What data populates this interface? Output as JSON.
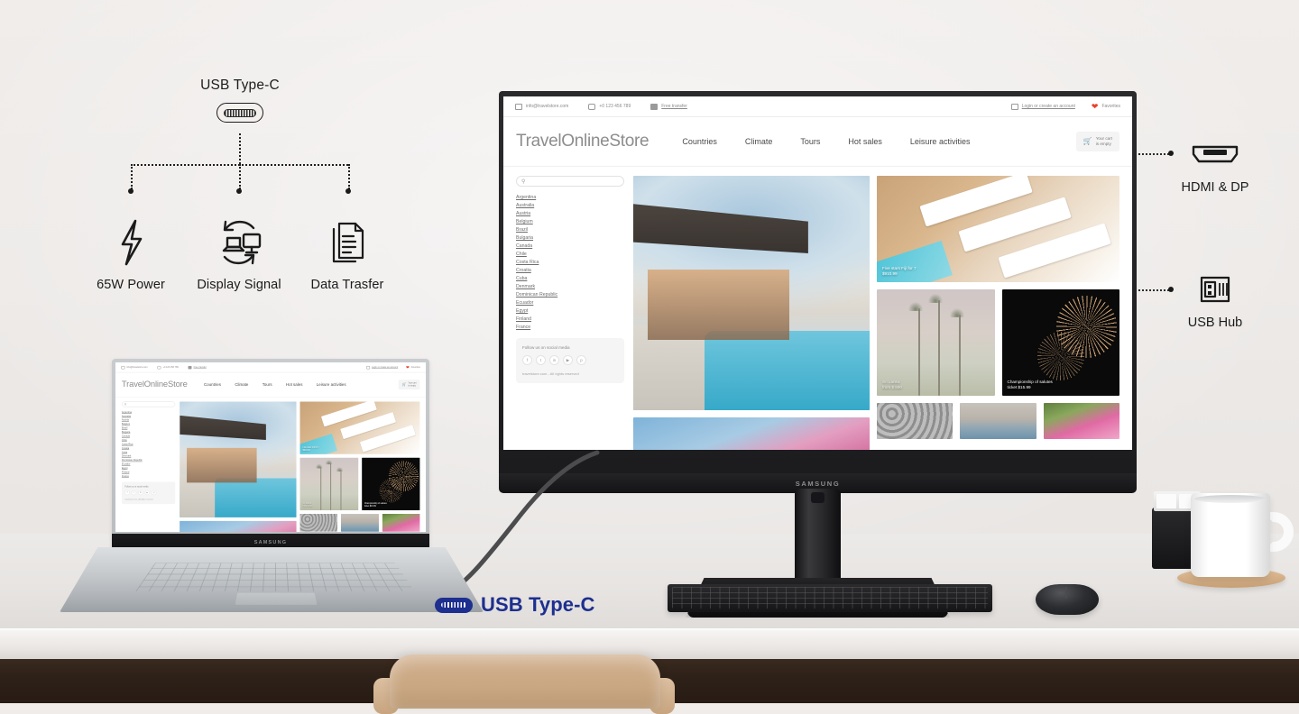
{
  "diagram": {
    "title": "USB Type-C",
    "connector_icon": "usb-c-icon",
    "features": [
      {
        "label": "65W Power",
        "icon": "bolt-icon"
      },
      {
        "label": "Display Signal",
        "icon": "display-sync-icon"
      },
      {
        "label": "Data Trasfer",
        "icon": "documents-icon"
      }
    ]
  },
  "callouts": [
    {
      "label": "HDMI & DP",
      "icon": "hdmi-port-icon"
    },
    {
      "label": "USB Hub",
      "icon": "usb-a-port-icon"
    }
  ],
  "bottom_badge": {
    "label": "USB Type-C",
    "icon": "usb-c-icon",
    "color": "#1d2f8f"
  },
  "devices": {
    "monitor_brand": "SAMSUNG",
    "laptop_brand": "SAMSUNG"
  },
  "website": {
    "topbar": {
      "email": "info@travelstore.com",
      "phone": "+0 123 456 789",
      "shipping": "Free transfer",
      "login": "Login or create an account",
      "favorites": "Favorites"
    },
    "brand": "TravelOnlineStore",
    "nav": [
      "Countries",
      "Climate",
      "Tours",
      "Hot sales",
      "Leisure activities"
    ],
    "cart": {
      "line1": "Your cart",
      "line2": "is empty"
    },
    "search_placeholder": "",
    "countries": [
      "Argentina",
      "Australia",
      "Austria",
      "Belgium",
      "Brazil",
      "Bulgaria",
      "Canada",
      "Chile",
      "Costa Rica",
      "Croatia",
      "Cuba",
      "Denmark",
      "Dominican Republic",
      "Ecuador",
      "Egypt",
      "Finland",
      "France"
    ],
    "social": {
      "title": "Follow us on social media",
      "icons": [
        "facebook-icon",
        "twitter-icon",
        "instagram-icon",
        "youtube-icon",
        "pinterest-icon"
      ],
      "copyright": "travelstore.com - All rights reserved"
    },
    "tiles": [
      {
        "name": "villa-pool-photo",
        "caption": ""
      },
      {
        "name": "loungers-photo",
        "caption_line1": "Five stars Fiji for 7",
        "caption_line2": "$910.99"
      },
      {
        "name": "palms-photo",
        "caption_line1": "Sri Lanka",
        "caption_line2": "from $ 590"
      },
      {
        "name": "fireworks-photo",
        "caption_line1": "Championship of salutes",
        "caption_line2": "ticket $15.99"
      },
      {
        "name": "flower-sky-photo",
        "caption": ""
      },
      {
        "name": "stones-photo",
        "caption": ""
      },
      {
        "name": "city-photo",
        "caption": ""
      },
      {
        "name": "pink-flowers-photo",
        "caption": ""
      }
    ]
  }
}
